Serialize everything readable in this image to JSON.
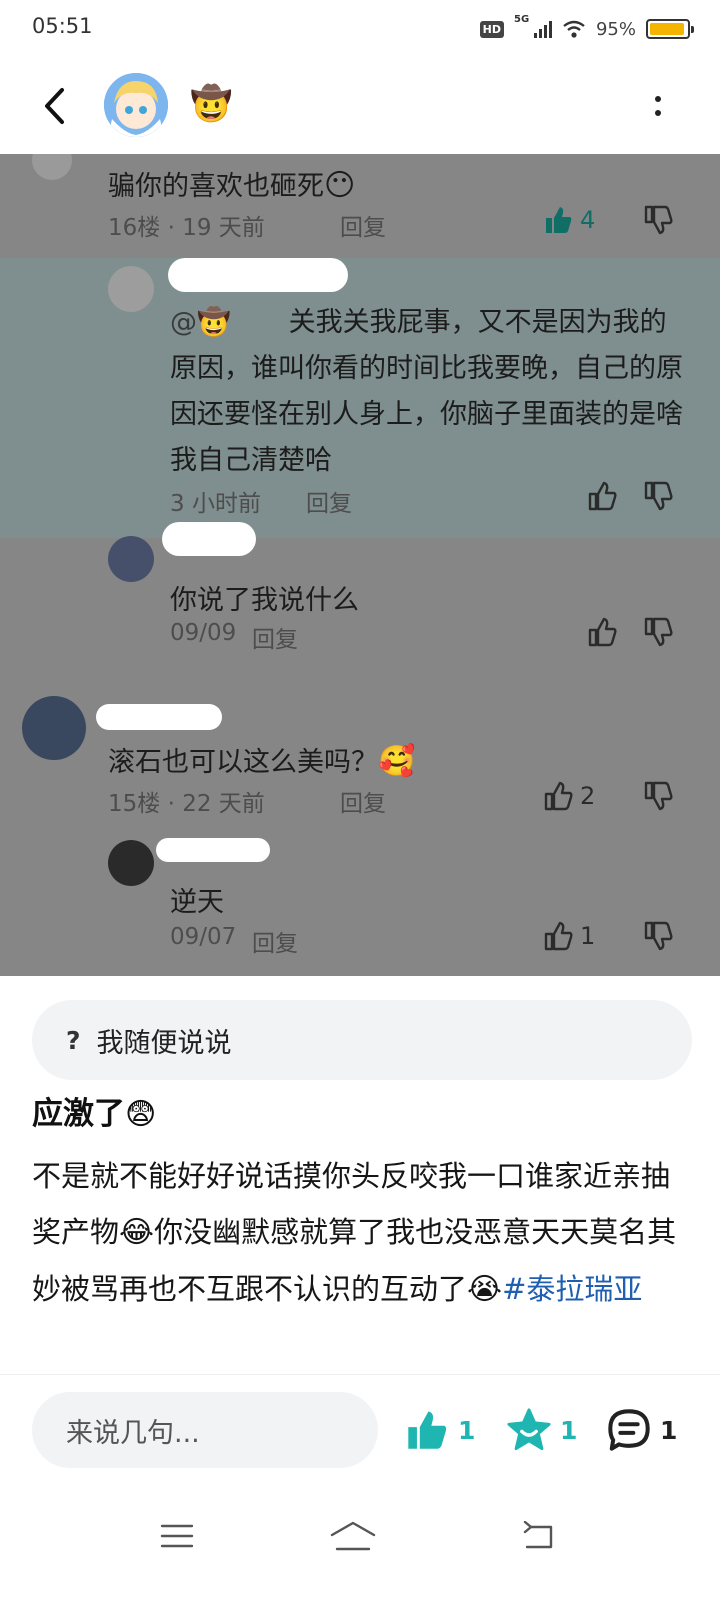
{
  "status_bar": {
    "time": "05:51",
    "network": "5G",
    "hd": "HD",
    "battery_percent": "95%",
    "battery_level": 0.95,
    "battery_color": "#f4b400"
  },
  "header": {
    "user_emoji": "🤠",
    "back_icon": "chevron-left-icon",
    "more_icon": "more-vertical-icon"
  },
  "comments": [
    {
      "text": "骗你的喜欢也砸死",
      "emoji": "😶",
      "floor": "16楼",
      "time": "19 天前",
      "reply_label": "回复",
      "likes": "4",
      "liked": true
    },
    {
      "mention": "@🤠",
      "text": "关我关我屁事，又不是因为我的原因，谁叫你看的时间比我要晚，自己的原因还要怪在别人身上，你脑子里面装的是啥我自己清楚哈",
      "time": "3 小时前",
      "reply_label": "回复"
    },
    {
      "text": "你说了我说什么",
      "time": "09/09",
      "reply_label": "回复"
    },
    {
      "text": "滚石也可以这么美吗？",
      "emoji": "🥰",
      "floor": "15楼",
      "time": "22 天前",
      "reply_label": "回复",
      "likes": "2"
    },
    {
      "text": "逆天",
      "time": "09/07",
      "reply_label": "回复",
      "likes": "1"
    }
  ],
  "post": {
    "question_label": "我随便说说",
    "question_mark": "?",
    "title": "应激了",
    "title_emoji": "😨",
    "body_part1": "不是就不能好好说话摸你头反咬我一口谁家近亲抽奖产物",
    "body_emoji1": "😂",
    "body_part2": "你没幽默感就算了我也没恶意天天莫名其妙被骂再也不互跟不认识的互动了",
    "body_emoji2": "😭",
    "hashtag": "#泰拉瑞亚"
  },
  "bottom_bar": {
    "input_placeholder": "来说几句...",
    "like_count": "1",
    "favorite_count": "1",
    "comment_count": "1",
    "accent_color": "#1fb5b0"
  },
  "colors": {
    "overlay": "#868686",
    "highlight_band": "#7f8e8e",
    "liked": "#0f6e66",
    "hashtag": "#1f5fb0"
  }
}
